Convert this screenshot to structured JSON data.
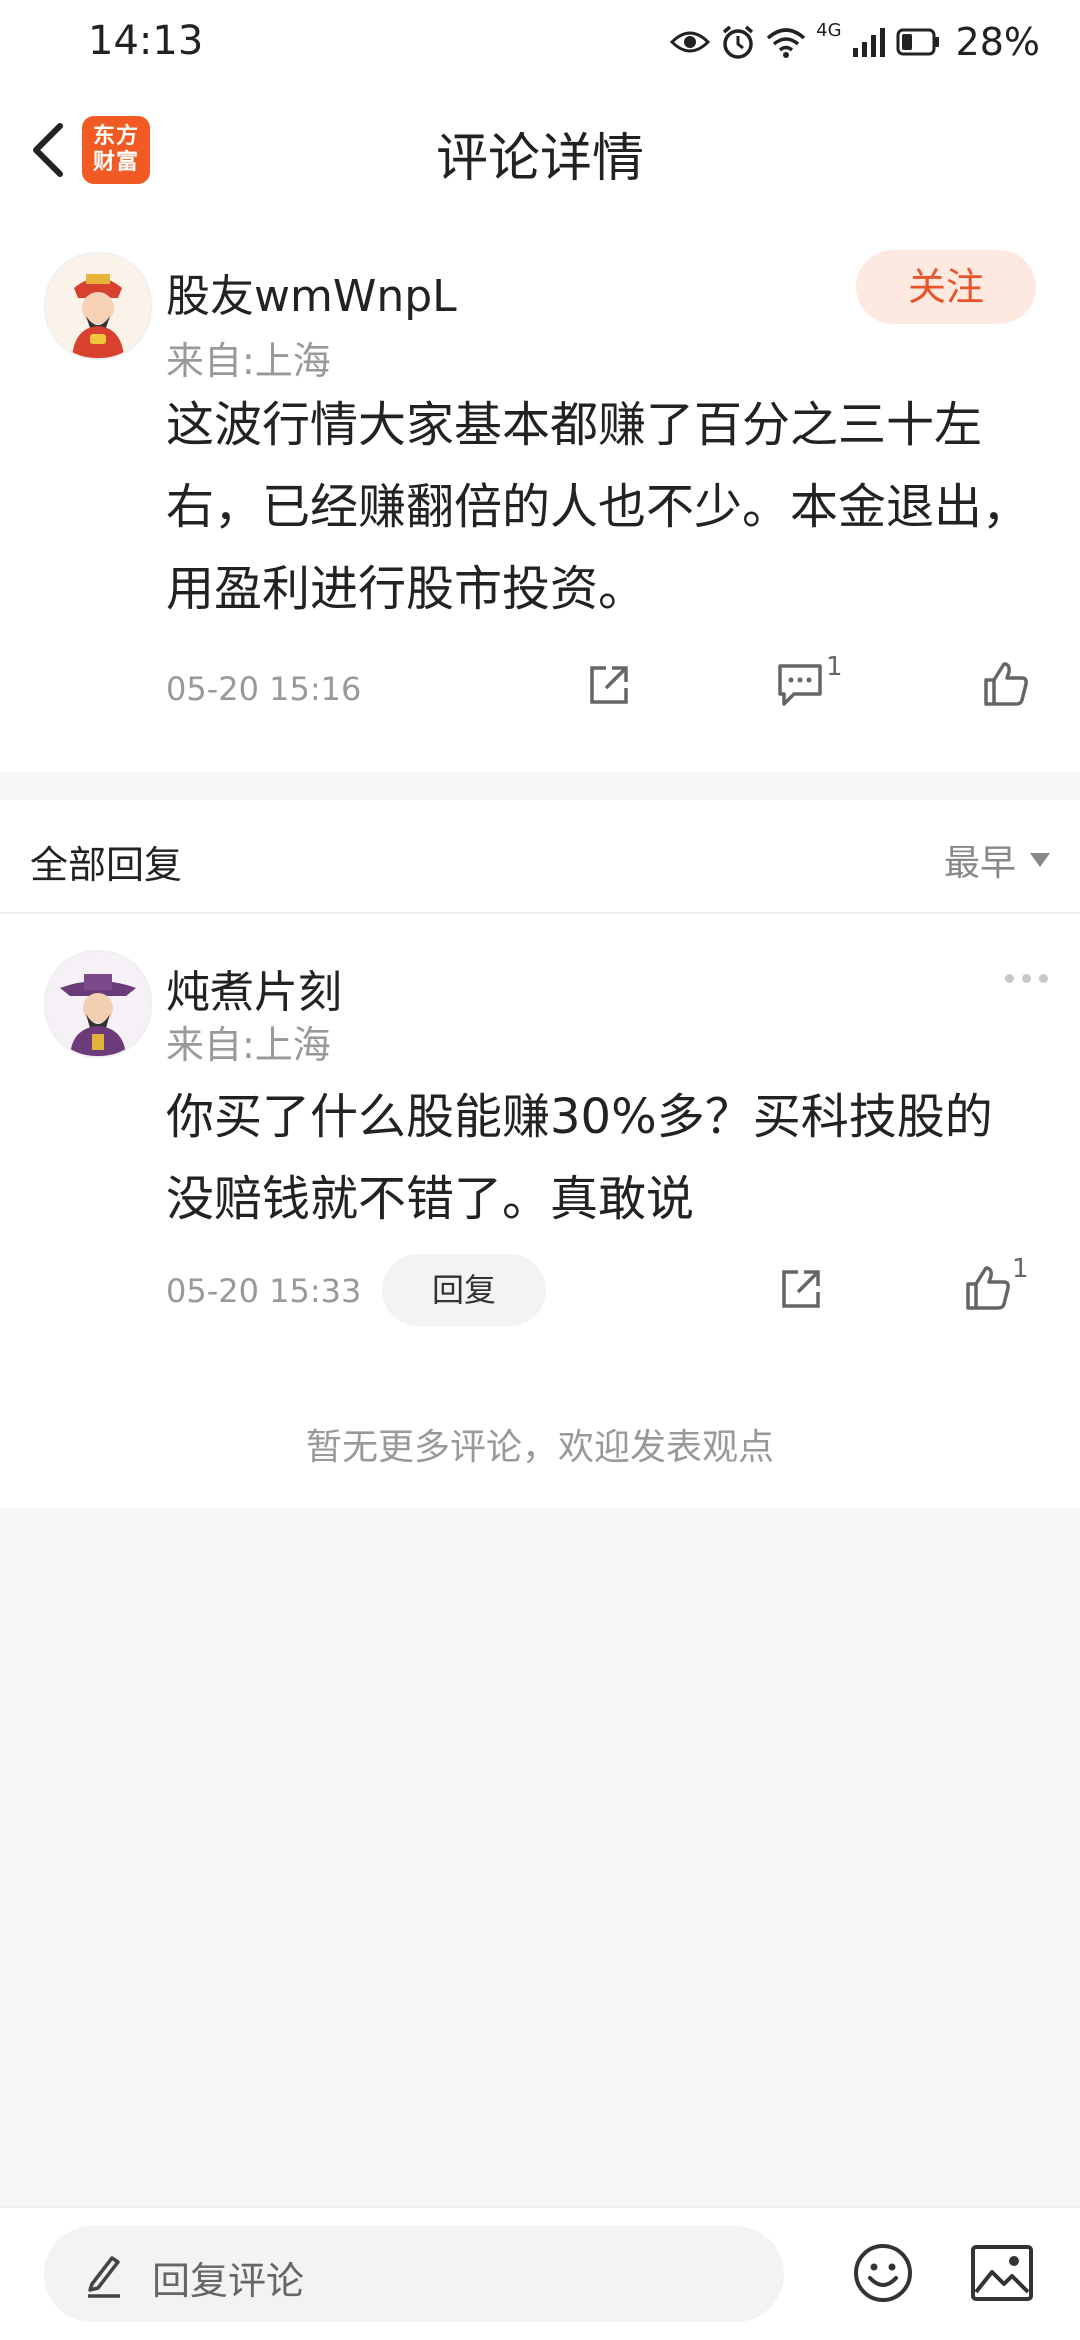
{
  "status_bar": {
    "time": "14:13",
    "battery": "28%",
    "network": "4G",
    "icons": [
      "eye-icon",
      "alarm-icon",
      "wifi-icon",
      "signal-icon",
      "battery-icon"
    ]
  },
  "header": {
    "title": "评论详情",
    "logo_line1": "东方",
    "logo_line2": "财富"
  },
  "main_comment": {
    "username": "股友wmWnpL",
    "location": "来自:上海",
    "follow_label": "关注",
    "content": "这波行情大家基本都赚了百分之三十左右，已经赚翻倍的人也不少。本金退出，用盈利进行股市投资。",
    "time": "05-20 15:16",
    "comment_count": "1"
  },
  "replies_section": {
    "title": "全部回复",
    "sort_label": "最早"
  },
  "reply": {
    "username": "炖煮片刻",
    "location": "来自:上海",
    "content": "你买了什么股能赚30%多？买科技股的没赔钱就不错了。真敢说",
    "time": "05-20 15:33",
    "reply_label": "回复",
    "like_count": "1"
  },
  "no_more_text": "暂无更多评论，欢迎发表观点",
  "bottom_bar": {
    "placeholder": "回复评论"
  },
  "colors": {
    "accent": "#e8542a",
    "follow_bg": "#fde9e0",
    "logo_bg": "#f15a22",
    "page_bg": "#f5f6f8"
  }
}
